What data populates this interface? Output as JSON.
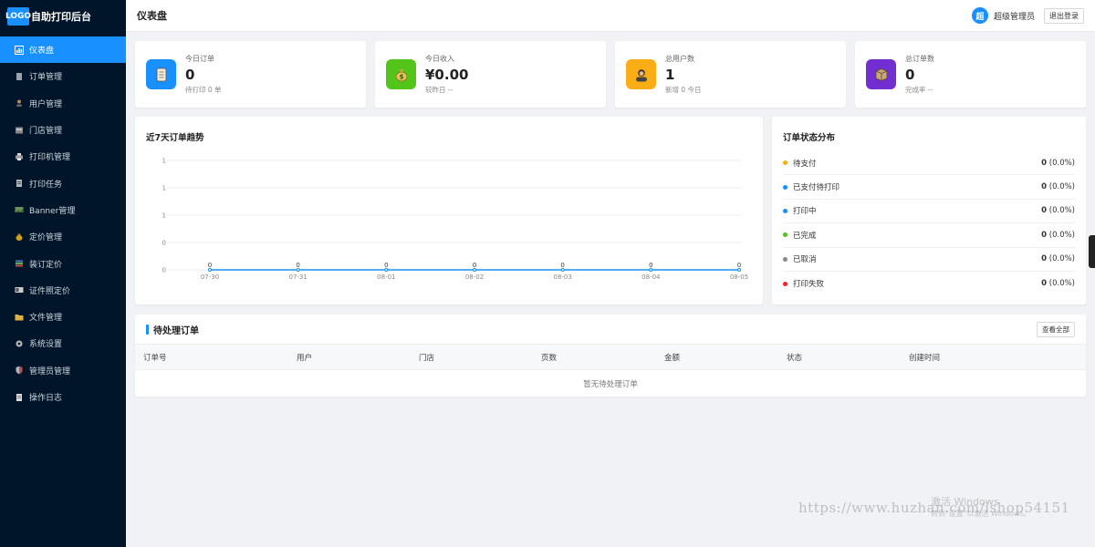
{
  "brand": {
    "logo_text": "LOGO",
    "title": "自助打印后台"
  },
  "sidebar": {
    "items": [
      {
        "label": "仪表盘",
        "icon": "dashboard-icon",
        "active": true
      },
      {
        "label": "订单管理",
        "icon": "order-icon"
      },
      {
        "label": "用户管理",
        "icon": "user-icon"
      },
      {
        "label": "门店管理",
        "icon": "store-icon"
      },
      {
        "label": "打印机管理",
        "icon": "printer-icon"
      },
      {
        "label": "打印任务",
        "icon": "task-icon"
      },
      {
        "label": "Banner管理",
        "icon": "banner-icon"
      },
      {
        "label": "定价管理",
        "icon": "price-icon"
      },
      {
        "label": "装订定价",
        "icon": "binding-icon"
      },
      {
        "label": "证件照定价",
        "icon": "id-photo-icon"
      },
      {
        "label": "文件管理",
        "icon": "folder-icon"
      },
      {
        "label": "系统设置",
        "icon": "gear-icon"
      },
      {
        "label": "管理员管理",
        "icon": "shield-icon"
      },
      {
        "label": "操作日志",
        "icon": "log-icon"
      }
    ]
  },
  "header": {
    "title": "仪表盘",
    "avatar_text": "超",
    "admin_name": "超级管理员",
    "logout_label": "退出登录"
  },
  "stats": [
    {
      "label": "今日订单",
      "value": "0",
      "sub": "待打印 0 单",
      "icon": "scroll-icon",
      "color": "#1890ff"
    },
    {
      "label": "今日收入",
      "value": "¥0.00",
      "sub": "较昨日 --",
      "icon": "money-bag-icon",
      "color": "#52c41a"
    },
    {
      "label": "总用户数",
      "value": "1",
      "sub": "新增 0 今日",
      "icon": "user-avatar-icon",
      "color": "#faad14"
    },
    {
      "label": "总订单数",
      "value": "0",
      "sub": "完成率 --",
      "icon": "package-icon",
      "color": "#722ed1"
    }
  ],
  "trend": {
    "title": "近7天订单趋势"
  },
  "chart_data": {
    "type": "line",
    "title": "近7天订单趋势",
    "categories": [
      "07-30",
      "07-31",
      "08-01",
      "08-02",
      "08-03",
      "08-04",
      "08-05"
    ],
    "values": [
      0,
      0,
      0,
      0,
      0,
      0,
      0
    ],
    "data_labels": [
      "0",
      "0",
      "0",
      "0",
      "0",
      "0",
      "0"
    ],
    "y_tick_labels": [
      "1",
      "1",
      "1",
      "0",
      "0"
    ],
    "grid": true,
    "color": "#1890ff"
  },
  "status_dist": {
    "title": "订单状态分布",
    "items": [
      {
        "label": "待支付",
        "count": "0",
        "pct": "(0.0%)",
        "color": "#faad14"
      },
      {
        "label": "已支付待打印",
        "count": "0",
        "pct": "(0.0%)",
        "color": "#1890ff"
      },
      {
        "label": "打印中",
        "count": "0",
        "pct": "(0.0%)",
        "color": "#1890ff"
      },
      {
        "label": "已完成",
        "count": "0",
        "pct": "(0.0%)",
        "color": "#52c41a"
      },
      {
        "label": "已取消",
        "count": "0",
        "pct": "(0.0%)",
        "color": "#888888"
      },
      {
        "label": "打印失败",
        "count": "0",
        "pct": "(0.0%)",
        "color": "#f5222d"
      }
    ]
  },
  "pending": {
    "title": "待处理订单",
    "view_all_label": "查看全部",
    "columns": [
      "订单号",
      "用户",
      "门店",
      "页数",
      "金额",
      "状态",
      "创建时间"
    ],
    "empty_text": "暂无待处理订单"
  },
  "watermark": {
    "url": "https://www.huzhan.com/ishop54151",
    "win_title": "激活 Windows",
    "win_sub": "转到\"设置\"以激活 Windows。"
  }
}
